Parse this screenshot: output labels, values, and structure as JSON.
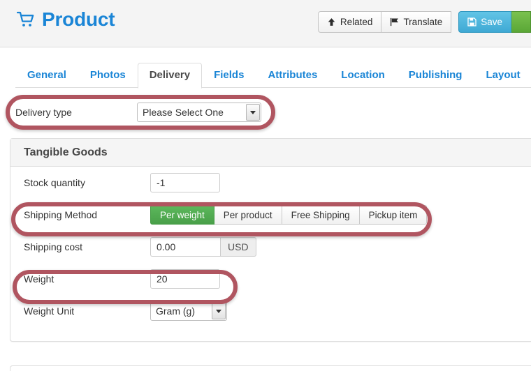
{
  "header": {
    "title": "Product",
    "cart_icon": "shopping-cart-icon",
    "buttons": {
      "related": "Related",
      "related_icon": "arrow-up-icon",
      "translate": "Translate",
      "translate_icon": "flag-icon",
      "save": "Save",
      "save_icon": "floppy-disk-icon"
    }
  },
  "tabs": [
    {
      "label": "General",
      "active": false
    },
    {
      "label": "Photos",
      "active": false
    },
    {
      "label": "Delivery",
      "active": true
    },
    {
      "label": "Fields",
      "active": false
    },
    {
      "label": "Attributes",
      "active": false
    },
    {
      "label": "Location",
      "active": false
    },
    {
      "label": "Publishing",
      "active": false
    },
    {
      "label": "Layout",
      "active": false
    }
  ],
  "form": {
    "delivery_type": {
      "label": "Delivery type",
      "value": "Please Select One"
    }
  },
  "panel": {
    "title": "Tangible Goods",
    "stock_quantity": {
      "label": "Stock quantity",
      "value": "-1"
    },
    "shipping_method": {
      "label": "Shipping Method",
      "options": [
        {
          "label": "Per weight",
          "active": true
        },
        {
          "label": "Per product",
          "active": false
        },
        {
          "label": "Free Shipping",
          "active": false
        },
        {
          "label": "Pickup item",
          "active": false
        }
      ]
    },
    "shipping_cost": {
      "label": "Shipping cost",
      "value": "0.00",
      "currency": "USD"
    },
    "weight": {
      "label": "Weight",
      "value": "20"
    },
    "weight_unit": {
      "label": "Weight Unit",
      "value": "Gram (g)"
    }
  },
  "annotations": {
    "color": "#b05560",
    "targets": [
      "delivery-type",
      "shipping-method",
      "weight"
    ]
  },
  "colors": {
    "link_blue": "#1a85d6",
    "save_blue": "#3fa9d4",
    "active_green": "#49a049",
    "annotation_red": "#b05560",
    "header_bg": "#f4f4f4"
  }
}
